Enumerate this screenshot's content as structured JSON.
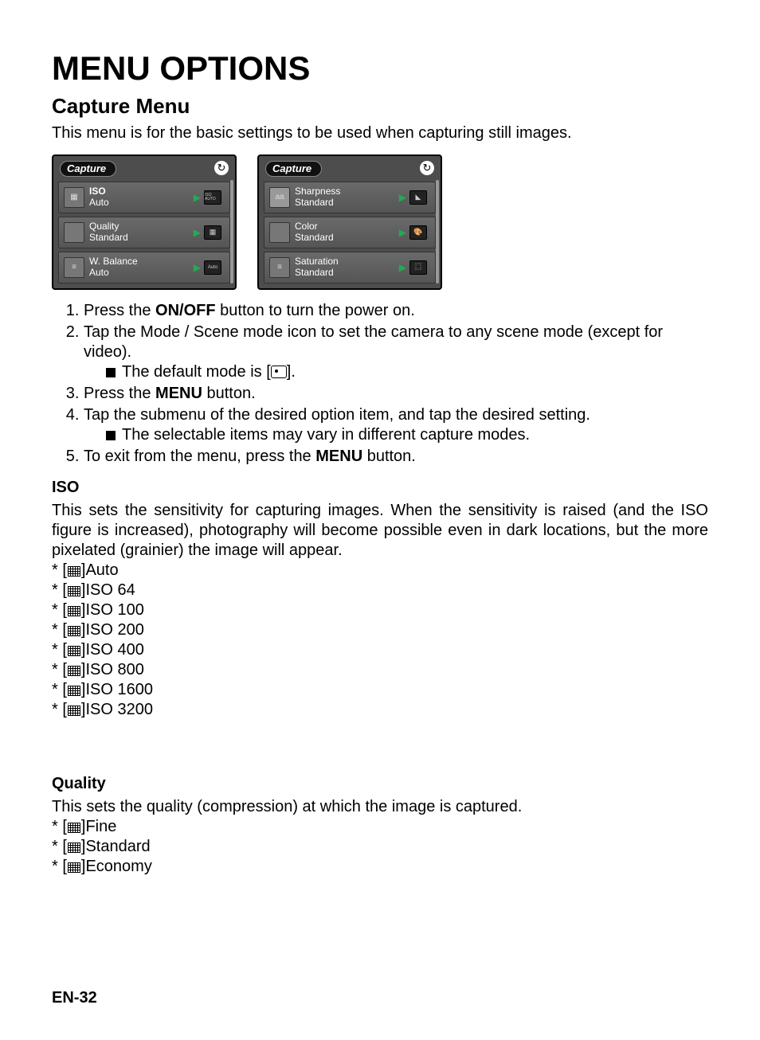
{
  "title": "MENU OPTIONS",
  "section": "Capture Menu",
  "intro": "This menu is for the basic settings to be used when capturing still images.",
  "screens": [
    {
      "tab": "Capture",
      "rows": [
        {
          "icon": "iso-icon",
          "title": "ISO",
          "sub": "Auto",
          "right_text": "ISO AUTO"
        },
        {
          "icon": "quality-icon",
          "title": "Quality",
          "sub": "Standard",
          "right_text": ""
        },
        {
          "icon": "wb-icon",
          "title": "W. Balance",
          "sub": "Auto",
          "right_text": "Auto"
        }
      ]
    },
    {
      "tab": "Capture",
      "rows": [
        {
          "icon": "sharpness-icon",
          "title": "Sharpness",
          "sub": "Standard",
          "right_text": ""
        },
        {
          "icon": "color-icon",
          "title": "Color",
          "sub": "Standard",
          "right_text": ""
        },
        {
          "icon": "saturation-icon",
          "title": "Saturation",
          "sub": "Standard",
          "right_text": ""
        }
      ]
    }
  ],
  "steps": {
    "s1a": "Press the ",
    "s1b": "ON/OFF",
    "s1c": " button to turn the power on.",
    "s2": "Tap the Mode / Scene  mode icon to set the camera to any scene mode  (except for video).",
    "s2sub": "The default mode is [",
    "s2sub2": "].",
    "s3a": "Press the ",
    "s3b": "MENU",
    "s3c": " button.",
    "s4": "Tap the submenu of the desired option item, and tap the desired setting.",
    "s4sub": "The selectable items may vary in different capture modes.",
    "s5a": "To exit from the menu, press the ",
    "s5b": "MENU",
    "s5c": " button."
  },
  "iso": {
    "heading": "ISO",
    "desc": "This sets the sensitivity for capturing images. When the sensitivity is raised (and the ISO figure is increased), photography will become possible even in dark locations, but the more pixelated (grainier) the image will appear.",
    "options": [
      "Auto",
      "ISO  64",
      "ISO  100",
      "ISO  200",
      "ISO  400",
      "ISO  800",
      "ISO  1600",
      "ISO  3200"
    ]
  },
  "quality": {
    "heading": "Quality",
    "desc": "This sets the quality (compression) at which the image is captured.",
    "options": [
      "Fine",
      "Standard",
      "Economy"
    ]
  },
  "footer": "EN-32"
}
